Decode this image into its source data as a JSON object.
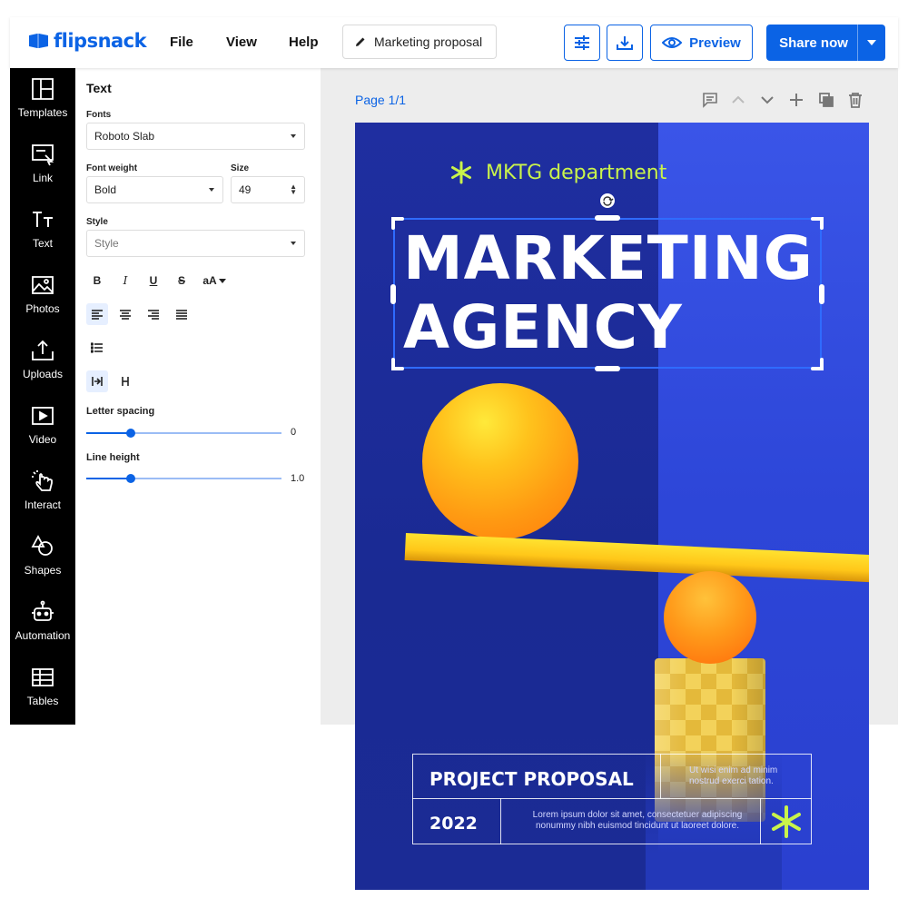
{
  "app": {
    "logo_text": "flipsnack",
    "menu": [
      "File",
      "View",
      "Help"
    ],
    "document_name": "Marketing proposal",
    "preview_label": "Preview",
    "share_label": "Share now",
    "accent_color": "#0b63e5"
  },
  "sidebar": {
    "items": [
      {
        "label": "Templates",
        "icon": "templates-icon"
      },
      {
        "label": "Link",
        "icon": "link-icon"
      },
      {
        "label": "Text",
        "icon": "text-icon"
      },
      {
        "label": "Photos",
        "icon": "photos-icon"
      },
      {
        "label": "Uploads",
        "icon": "uploads-icon"
      },
      {
        "label": "Video",
        "icon": "video-icon"
      },
      {
        "label": "Interact",
        "icon": "interact-icon"
      },
      {
        "label": "Shapes",
        "icon": "shapes-icon"
      },
      {
        "label": "Automation",
        "icon": "automation-icon"
      },
      {
        "label": "Tables",
        "icon": "tables-icon"
      }
    ]
  },
  "text_panel": {
    "heading": "Text",
    "fonts_label": "Fonts",
    "font_value": "Roboto Slab",
    "weight_label": "Font weight",
    "weight_value": "Bold",
    "size_label": "Size",
    "size_value": "49",
    "style_label": "Style",
    "style_placeholder": "Style",
    "format_buttons": {
      "bold": "B",
      "italic": "I",
      "underline": "U",
      "strike": "S",
      "case": "aA"
    },
    "letter_spacing_label": "Letter spacing",
    "letter_spacing_value": "0",
    "letter_spacing_level": 0.23,
    "line_height_label": "Line height",
    "line_height_value": "1.0",
    "line_height_level": 0.23
  },
  "canvas": {
    "page_label": "Page 1/1"
  },
  "poster": {
    "department": "MKTG department",
    "title_line1": "MARKETING",
    "title_line2": "AGENCY",
    "project_title": "PROJECT PROPOSAL",
    "project_note": "Ut wisi enim ad minim nostrud exerci tation.",
    "year": "2022",
    "body_text": "Lorem ipsum dolor sit amet, consectetuer adipiscing nonummy nibh euismod tincidunt ut laoreet dolore.",
    "lime_color": "#c9f34b",
    "navy_color": "#1d2f9a"
  }
}
